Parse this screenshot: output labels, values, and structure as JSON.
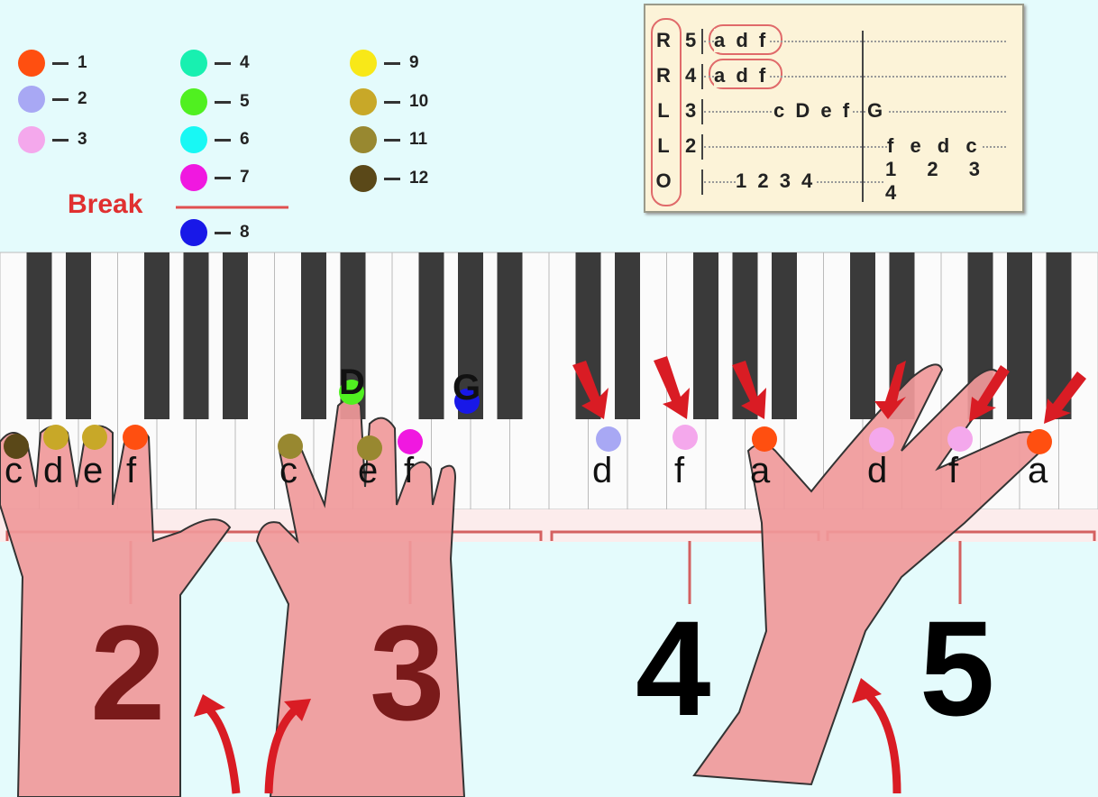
{
  "legend": {
    "items": [
      {
        "label": "1",
        "color": "#ff4f10"
      },
      {
        "label": "2",
        "color": "#a8a8f4"
      },
      {
        "label": "3",
        "color": "#f4a8ec"
      },
      {
        "label": "4",
        "color": "#18f0b0"
      },
      {
        "label": "5",
        "color": "#50f020"
      },
      {
        "label": "6",
        "color": "#18f8f4"
      },
      {
        "label": "7",
        "color": "#f018e0"
      },
      {
        "label": "8",
        "color": "#1818e8"
      },
      {
        "label": "9",
        "color": "#f8e818"
      },
      {
        "label": "10",
        "color": "#c8a828"
      },
      {
        "label": "11",
        "color": "#988830"
      },
      {
        "label": "12",
        "color": "#5a4818"
      }
    ],
    "break_label": "Break"
  },
  "tab": {
    "rows": [
      {
        "hand": "R",
        "string": "5",
        "notes1": "a d f",
        "notes2": ""
      },
      {
        "hand": "R",
        "string": "4",
        "notes1": "a d f",
        "notes2": ""
      },
      {
        "hand": "L",
        "string": "3",
        "notes1": "c D e f",
        "notes2": "G"
      },
      {
        "hand": "L",
        "string": "2",
        "notes1": "",
        "notes2": "f e d c"
      },
      {
        "hand": "O",
        "string": "",
        "notes1": "1 2 3 4",
        "notes2": "1 2 3 4"
      }
    ]
  },
  "keyboard": {
    "notes": [
      "c",
      "d",
      "e",
      "f",
      "c",
      "e",
      "f",
      "d",
      "f",
      "a",
      "d",
      "f",
      "a"
    ],
    "black_labels": [
      "D",
      "G"
    ]
  },
  "positions": [
    "2",
    "3",
    "4",
    "5"
  ],
  "colors": {
    "hand": "#f0999a",
    "arrow": "#d91c24",
    "position_dark": "#7a1a1a"
  }
}
